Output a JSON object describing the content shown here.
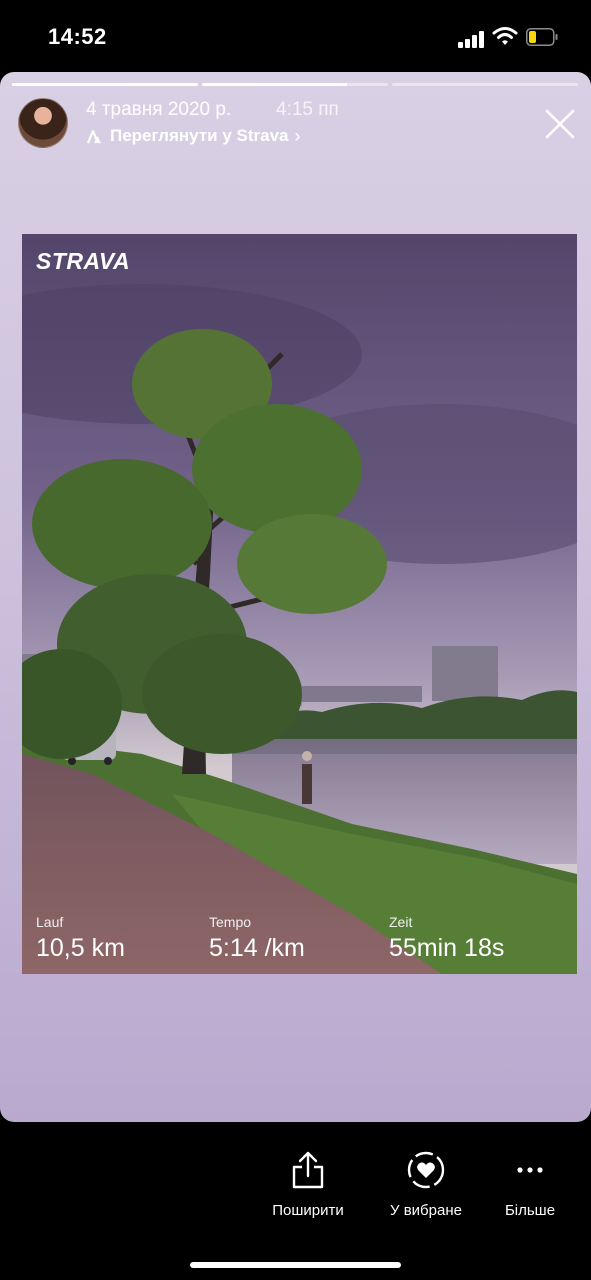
{
  "status_bar": {
    "time": "14:52"
  },
  "story": {
    "progress": [
      1.0,
      0.78,
      0.0
    ],
    "date": "4 травня 2020 р.",
    "time": "4:15 пп",
    "link_label": "Переглянути у Strava"
  },
  "activity": {
    "logo": "STRAVA",
    "stats": [
      {
        "label": "Lauf",
        "value": "10,5 km"
      },
      {
        "label": "Tempo",
        "value": "5:14 /km"
      },
      {
        "label": "Zeit",
        "value": "55min 18s"
      }
    ]
  },
  "actions": {
    "share": "Поширити",
    "favorite": "У вибране",
    "more": "Більше"
  },
  "icons": {
    "signal": "cellular-signal-icon",
    "wifi": "wifi-icon",
    "battery": "battery-low-icon",
    "strava": "strava-chevron-icon",
    "close": "close-icon",
    "share": "share-icon",
    "favorite": "heart-circle-icon",
    "more": "more-dots-icon"
  },
  "colors": {
    "battery_level": "#f5d90a",
    "card_bg": "#cfc4de"
  }
}
